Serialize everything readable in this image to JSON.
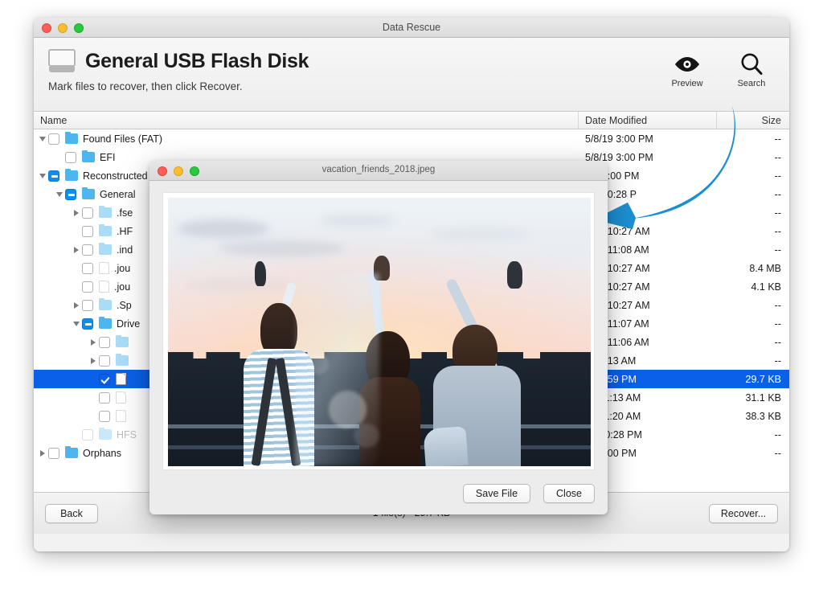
{
  "window": {
    "title": "Data Rescue",
    "traffic_lights": [
      "close",
      "minimize",
      "zoom"
    ]
  },
  "header": {
    "disk_icon": "hard-disk-icon",
    "title": "General USB Flash Disk",
    "subtitle": "Mark files to recover, then click Recover.",
    "toolbar": [
      {
        "icon": "eye-icon",
        "label": "Preview"
      },
      {
        "icon": "magnifier-icon",
        "label": "Search"
      }
    ]
  },
  "columns": {
    "name": "Name",
    "date": "Date Modified",
    "size": "Size"
  },
  "rows": [
    {
      "indent": 0,
      "twisty": "down",
      "check": "empty",
      "icon": "folder",
      "name": "Found Files (FAT)",
      "date": "5/8/19 3:00 PM",
      "size": "--"
    },
    {
      "indent": 1,
      "twisty": "none",
      "check": "empty",
      "icon": "folder",
      "name": "EFI",
      "date": "5/8/19 3:00 PM",
      "size": "--"
    },
    {
      "indent": 0,
      "twisty": "down",
      "check": "mixed",
      "icon": "folder",
      "name": "Reconstructed",
      "date": "/19 3:00 PM",
      "size": "--"
    },
    {
      "indent": 1,
      "twisty": "down",
      "check": "mixed",
      "icon": "folder",
      "name": "General",
      "date": "/18 10:28 P",
      "size": "--"
    },
    {
      "indent": 2,
      "twisty": "right",
      "check": "empty",
      "icon": "folder-pale",
      "name": ".fse",
      "date": "",
      "size": "--"
    },
    {
      "indent": 2,
      "twisty": "none",
      "check": "empty",
      "icon": "folder-pale",
      "name": ".HF",
      "date": "0/18 10:27 AM",
      "size": "--"
    },
    {
      "indent": 2,
      "twisty": "right",
      "check": "empty",
      "icon": "folder-pale",
      "name": ".ind",
      "date": "0/18 11:08 AM",
      "size": "--"
    },
    {
      "indent": 2,
      "twisty": "none",
      "check": "empty",
      "icon": "doc-ghost",
      "name": ".jou",
      "date": "0/18 10:27 AM",
      "size": "8.4 MB"
    },
    {
      "indent": 2,
      "twisty": "none",
      "check": "empty",
      "icon": "doc-ghost",
      "name": ".jou",
      "date": "0/18 10:27 AM",
      "size": "4.1 KB"
    },
    {
      "indent": 2,
      "twisty": "right",
      "check": "empty",
      "icon": "folder-pale",
      "name": ".Sp",
      "date": "0/18 10:27 AM",
      "size": "--"
    },
    {
      "indent": 2,
      "twisty": "down",
      "check": "mixed",
      "icon": "folder",
      "name": "Drive",
      "date": "0/18 11:07 AM",
      "size": "--"
    },
    {
      "indent": 3,
      "twisty": "right",
      "check": "empty",
      "icon": "folder-pale",
      "name": "",
      "date": "0/18 11:06 AM",
      "size": "--"
    },
    {
      "indent": 3,
      "twisty": "right",
      "check": "empty",
      "icon": "folder-pale",
      "name": "",
      "date": "18 9:13 AM",
      "size": "--"
    },
    {
      "indent": 3,
      "twisty": "none",
      "check": "checked",
      "icon": "doc",
      "name": "",
      "date": "18 1:59 PM",
      "size": "29.7 KB",
      "selected": true
    },
    {
      "indent": 3,
      "twisty": "none",
      "check": "empty",
      "icon": "doc-ghost",
      "name": "",
      "date": "18 11:13 AM",
      "size": "31.1 KB"
    },
    {
      "indent": 3,
      "twisty": "none",
      "check": "empty",
      "icon": "doc-ghost",
      "name": "",
      "date": "18 11:20 AM",
      "size": "38.3 KB"
    },
    {
      "indent": 2,
      "twisty": "none",
      "check": "empty-dim",
      "icon": "folder-paler",
      "name": "HFS",
      "date": "40 10:28 PM",
      "size": "--"
    },
    {
      "indent": 0,
      "twisty": "right",
      "check": "empty",
      "icon": "folder",
      "name": "Orphans",
      "date": "19 3:00 PM",
      "size": "--"
    }
  ],
  "footer": {
    "back_label": "Back",
    "status": "1 file(s) - 29.7 KB",
    "recover_label": "Recover..."
  },
  "preview_dialog": {
    "title": "vacation_friends_2018.jpeg",
    "image_alt": "three friends at sunset with arms raised",
    "save_label": "Save File",
    "close_label": "Close",
    "traffic_lights": [
      "close",
      "minimize",
      "zoom"
    ]
  },
  "annotation": {
    "arrow": "curved-arrow-pointing-left",
    "color": "#1d8fd1"
  },
  "colors": {
    "selection": "#0a60e8",
    "folder": "#4db6ee",
    "annotation": "#1d8fd1"
  }
}
